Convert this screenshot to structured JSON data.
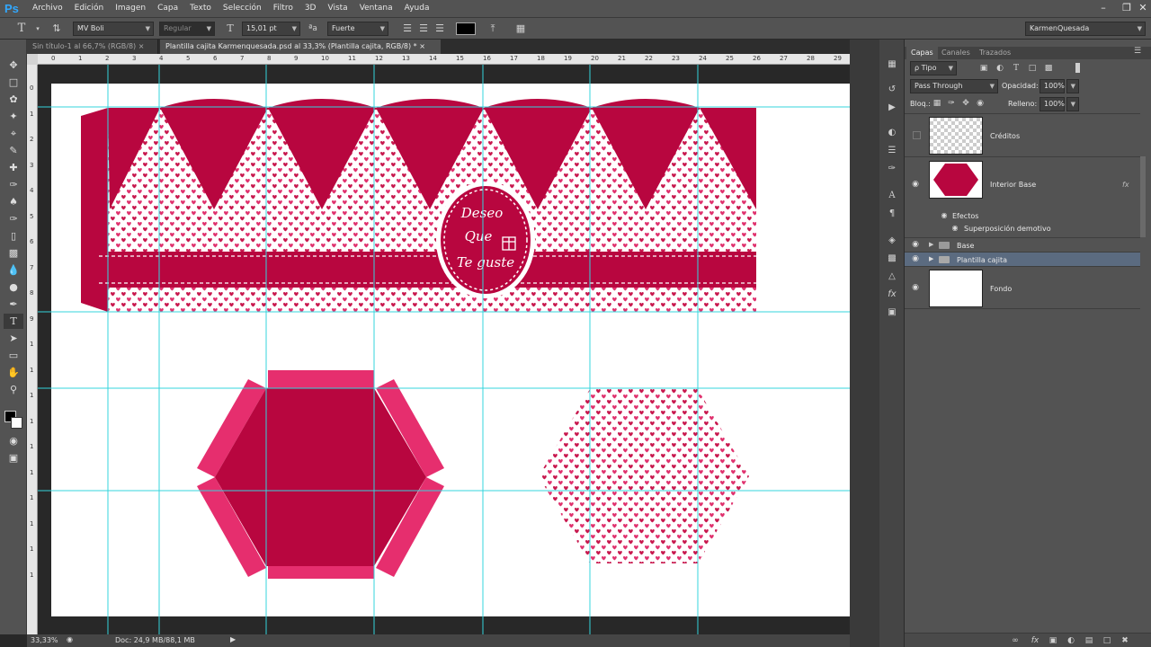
{
  "app": {
    "logo": "Ps"
  },
  "menu": [
    "Archivo",
    "Edición",
    "Imagen",
    "Capa",
    "Texto",
    "Selección",
    "Filtro",
    "3D",
    "Vista",
    "Ventana",
    "Ayuda"
  ],
  "options": {
    "font_family": "MV Boli",
    "font_style": "Regular",
    "font_size": "15,01 pt",
    "aa_label": "ªa",
    "antialias": "Fuerte",
    "workspace": "KarmenQuesada",
    "text_color": "#000000"
  },
  "tabs": [
    {
      "label": "Sin título-1 al 66,7% (RGB/8)"
    },
    {
      "label": "Plantilla cajita Karmenquesada.psd al 33,3% (Plantilla cajita, RGB/8) *"
    }
  ],
  "ruler_top": [
    "0",
    "1",
    "2",
    "3",
    "4",
    "5",
    "6",
    "7",
    "8",
    "9",
    "10",
    "11",
    "12",
    "13",
    "14",
    "15",
    "16",
    "17",
    "18",
    "19",
    "20",
    "21",
    "22",
    "23",
    "24",
    "25",
    "26",
    "27",
    "28",
    "29"
  ],
  "ruler_left": [
    "0",
    "1",
    "2",
    "3",
    "4",
    "5",
    "6",
    "7",
    "8",
    "9",
    "1",
    "1",
    "1",
    "1",
    "1",
    "1",
    "1",
    "1",
    "1",
    "1"
  ],
  "artwork": {
    "label_lines": [
      "Deseo",
      "Que",
      "Te guste"
    ],
    "colors": {
      "crimson": "#b8063f",
      "pink": "#e62e6e",
      "heart": "#c8184e"
    }
  },
  "status": {
    "zoom": "33,33%",
    "doc": "Doc: 24,9 MB/88,1 MB"
  },
  "panels": {
    "tabs": [
      "Capas",
      "Canales",
      "Trazados"
    ],
    "filter": "ρ Tipo",
    "blend_mode": "Pass Through",
    "opacity_label": "Opacidad:",
    "opacity": "100%",
    "lock_label": "Bloq.:",
    "fill_label": "Relleno:",
    "fill": "100%",
    "layers": [
      {
        "name": "Créditos"
      },
      {
        "name": "Interior Base",
        "fx": "fx"
      },
      {
        "name": "Efectos"
      },
      {
        "name": "Superposición demotivo"
      },
      {
        "name": "Base"
      },
      {
        "name": "Plantilla cajita"
      },
      {
        "name": "Fondo"
      }
    ]
  }
}
